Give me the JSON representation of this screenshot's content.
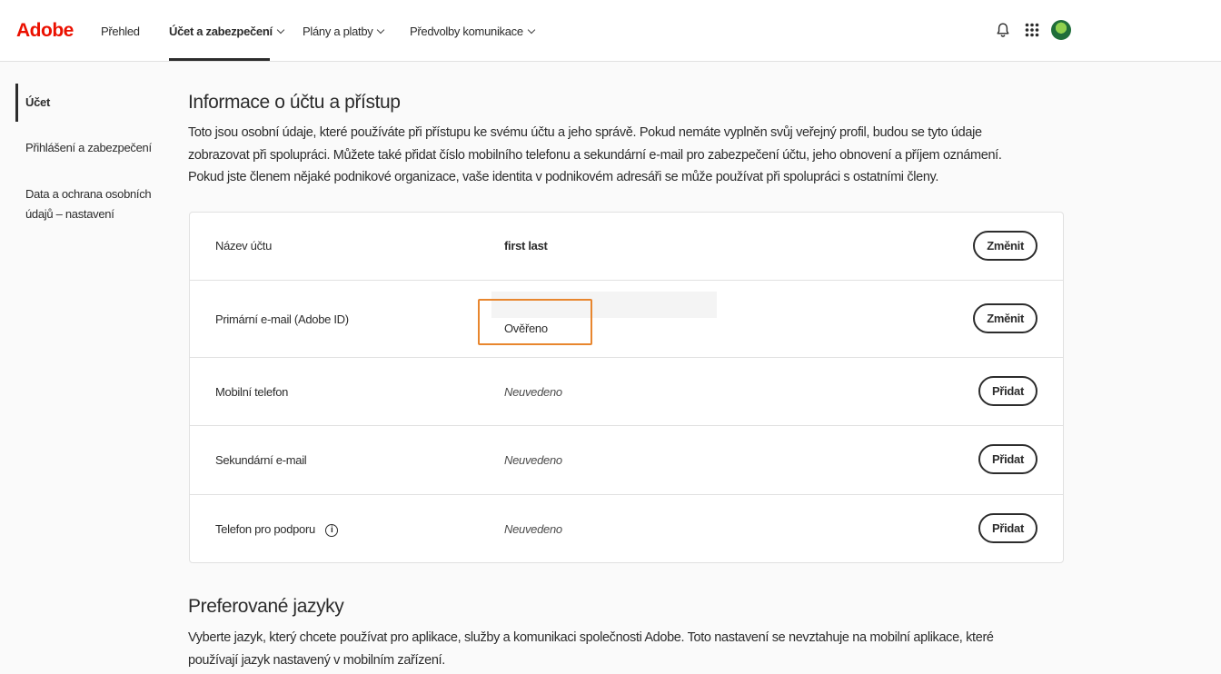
{
  "header": {
    "logo": "Adobe",
    "nav": [
      {
        "label": "Přehled"
      },
      {
        "label": "Účet a zabezpečení"
      },
      {
        "label": "Plány a platby"
      },
      {
        "label": "Předvolby komunikace"
      }
    ],
    "icons": [
      "bell-icon",
      "app-grid-icon",
      "avatar"
    ]
  },
  "sidebar": {
    "items": [
      {
        "label": "Účet"
      },
      {
        "label": "Přihlášení a zabezpečení"
      },
      {
        "label": "Data a ochrana osobních údajů – nastavení"
      }
    ]
  },
  "account_section": {
    "title": "Informace o účtu a přístup",
    "description": "Toto jsou osobní údaje, které používáte při přístupu ke svému účtu a jeho správě. Pokud nemáte vyplněn svůj veřejný profil, budou se tyto údaje zobrazovat při spolupráci. Můžete také přidat číslo mobilního telefonu a sekundární e-mail pro zabezpečení účtu, jeho obnovení a příjem oznámení. Pokud jste členem nějaké podnikové organizace, vaše identita v podnikovém adresáři se může používat při spolupráci s ostatními členy.",
    "rows": [
      {
        "label": "Název účtu",
        "value": "first last",
        "button": "Změnit"
      },
      {
        "label": "Primární e-mail (Adobe ID)",
        "value": "Ověřeno",
        "button": "Změnit"
      },
      {
        "label": "Mobilní telefon",
        "value": "Neuvedeno",
        "button": "Přidat"
      },
      {
        "label": "Sekundární e-mail",
        "value": "Neuvedeno",
        "button": "Přidat"
      },
      {
        "label": "Telefon pro podporu",
        "value": "Neuvedeno",
        "button": "Přidat"
      }
    ]
  },
  "languages_section": {
    "title": "Preferované jazyky",
    "description": "Vyberte jazyk, který chcete používat pro aplikace, služby a komunikaci společnosti Adobe. Toto nastavení se nevztahuje na mobilní aplikace, které používají jazyk nastavený v mobilním zařízení."
  },
  "colors": {
    "brand": "#eb1000",
    "highlight": "#e8862e"
  }
}
